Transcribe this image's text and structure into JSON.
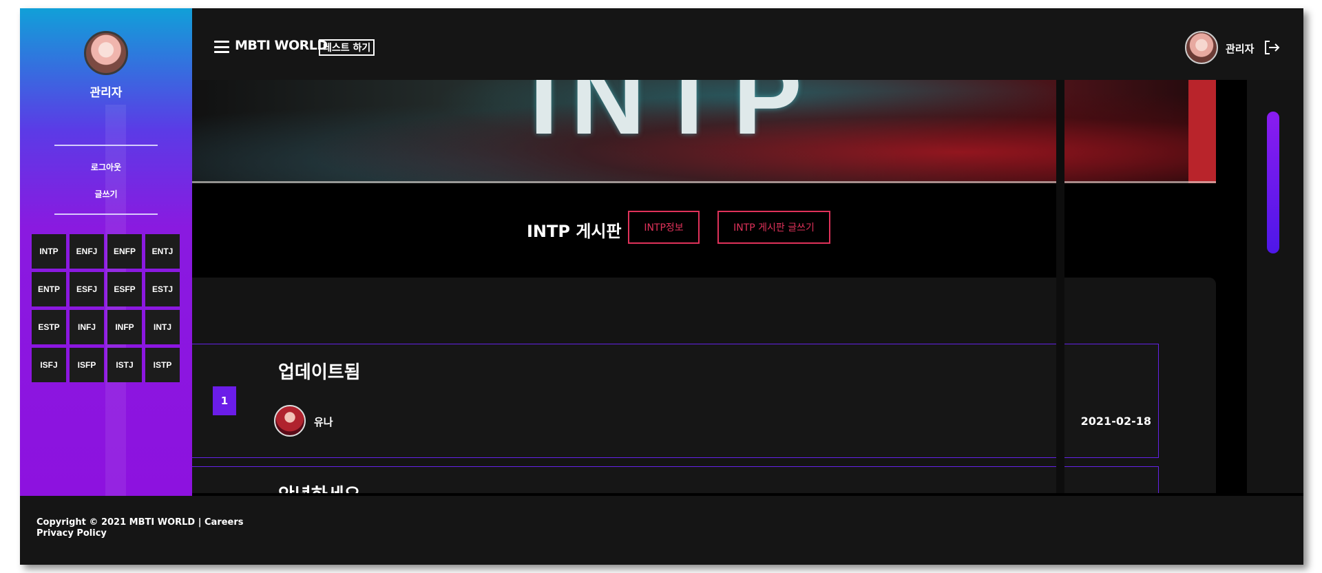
{
  "header": {
    "brand": "MBTI WORLD",
    "test_button": "테스트 하기",
    "user_name": "관리자"
  },
  "sidebar": {
    "user_name": "관리자",
    "logout": "로그아웃",
    "write": "글쓰기",
    "types": [
      "INTP",
      "ENFJ",
      "ENFP",
      "ENTJ",
      "ENTP",
      "ESFJ",
      "ESFP",
      "ESTJ",
      "ESTP",
      "INFJ",
      "INFP",
      "INTJ",
      "ISFJ",
      "ISFP",
      "ISTJ",
      "ISTP"
    ]
  },
  "hero": {
    "text": "INTP"
  },
  "board": {
    "title": "INTP 게시판",
    "info_button": "INTP정보",
    "write_button": "INTP 게시판 글쓰기"
  },
  "posts": [
    {
      "num": "1",
      "title": "업데이트됨",
      "author": "유나",
      "date": "2021-02-18"
    },
    {
      "title": "안녕하세요"
    }
  ],
  "footer": {
    "line1": "Copyright © 2021 MBTI WORLD | Careers",
    "line2": "Privacy Policy"
  },
  "colors": {
    "accent_pink": "#e0325a",
    "accent_purple": "#6b1de8",
    "sidebar_top": "#11a0d8",
    "sidebar_bottom": "#8d12df"
  }
}
